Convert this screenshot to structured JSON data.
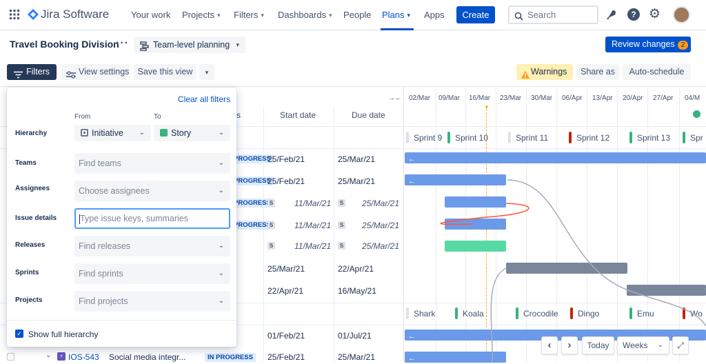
{
  "nav": {
    "logo": "Jira Software",
    "items": [
      {
        "label": "Your work",
        "caret": false
      },
      {
        "label": "Projects",
        "caret": true
      },
      {
        "label": "Filters",
        "caret": true
      },
      {
        "label": "Dashboards",
        "caret": true
      },
      {
        "label": "People",
        "caret": false
      },
      {
        "label": "Plans",
        "caret": true
      },
      {
        "label": "Apps",
        "caret": false
      }
    ],
    "create": "Create",
    "search_placeholder": "Search"
  },
  "header": {
    "title": "Travel Booking Division",
    "plan_view": "Team-level planning",
    "review": "Review changes",
    "review_count": "2"
  },
  "toolbar": {
    "filters": "Filters",
    "view_settings": "View settings",
    "save_view": "Save this view",
    "warnings": "Warnings",
    "share_as": "Share as",
    "auto_schedule": "Auto-schedule"
  },
  "table": {
    "col_start": "Start date",
    "col_due": "Due date",
    "col_status_fragment": "s",
    "rows": [
      {
        "status": "PROGRESS",
        "start": "25/Feb/21",
        "due": "25/Mar/21",
        "start_s": "",
        "due_s": ""
      },
      {
        "status": "PROGRESS",
        "start": "25/Feb/21",
        "due": "25/Mar/21",
        "start_s": "",
        "due_s": ""
      },
      {
        "status": "PROGRESS",
        "start": "11/Mar/21",
        "due": "25/Mar/21",
        "start_s": "S",
        "due_s": "S"
      },
      {
        "status": "PROGRESS",
        "start": "11/Mar/21",
        "due": "25/Mar/21",
        "start_s": "S",
        "due_s": "S"
      },
      {
        "status": "",
        "start": "11/Mar/21",
        "due": "25/Mar/21",
        "start_s": "S",
        "due_s": "S"
      },
      {
        "status": "",
        "start": "25/Mar/21",
        "due": "22/Apr/21",
        "start_s": "",
        "due_s": ""
      },
      {
        "status": "",
        "start": "22/Apr/21",
        "due": "16/May/21",
        "start_s": "",
        "due_s": ""
      },
      {
        "status": "",
        "start": "01/Feb/21",
        "due": "01/Jul/21",
        "start_s": "",
        "due_s": ""
      },
      {
        "status": "IN PROGRESS",
        "start": "25/Feb/21",
        "due": "25/Mar/21",
        "start_s": "",
        "due_s": ""
      }
    ],
    "bottom_row": {
      "key": "IOS-543",
      "summary": "Social media integr..."
    }
  },
  "timeline": {
    "dates": [
      "02/Mar",
      "09/Mar",
      "16/Mar",
      "23/Mar",
      "30/Mar",
      "06/Apr",
      "13/Apr",
      "20/Apr",
      "27/Apr",
      "04/M"
    ],
    "sprints": [
      {
        "name": "Sprint 9",
        "color": "#dfe1e6"
      },
      {
        "name": "Sprint 10",
        "color": "#36B37E"
      },
      {
        "name": "Sprint 11",
        "color": "#dfe1e6"
      },
      {
        "name": "Sprint 12",
        "color": "#BF2600"
      },
      {
        "name": "Sprint 13",
        "color": "#36B37E"
      },
      {
        "name": "Spr",
        "color": "#36B37E"
      }
    ],
    "teams": [
      {
        "name": "Shark",
        "color": "#dfe1e6"
      },
      {
        "name": "Koala",
        "color": "#36B37E"
      },
      {
        "name": "Crocodile",
        "color": "#36B37E"
      },
      {
        "name": "Dingo",
        "color": "#BF2600"
      },
      {
        "name": "Emu",
        "color": "#36B37E"
      },
      {
        "name": "Wo",
        "color": "#BF2600"
      }
    ],
    "bar_blue": "#6B9AE8",
    "bar_green": "#57D9A3",
    "bar_grey": "#7A869A",
    "today_color": "#FFAB00"
  },
  "filters": {
    "clear": "Clear all filters",
    "from_label": "From",
    "to_label": "To",
    "hierarchy_label": "Hierarchy",
    "hierarchy_from": "Initiative",
    "hierarchy_to": "Story",
    "teams_label": "Teams",
    "teams_placeholder": "Find teams",
    "assignees_label": "Assignees",
    "assignees_placeholder": "Choose assignees",
    "details_label": "Issue details",
    "details_placeholder": "Type issue keys, summaries",
    "releases_label": "Releases",
    "releases_placeholder": "Find releases",
    "sprints_label": "Sprints",
    "sprints_placeholder": "Find sprints",
    "projects_label": "Projects",
    "projects_placeholder": "Find projects",
    "show_hierarchy": "Show full hierarchy"
  },
  "controls": {
    "prev": "‹",
    "next": "›",
    "today": "Today",
    "zoom": "Weeks"
  }
}
